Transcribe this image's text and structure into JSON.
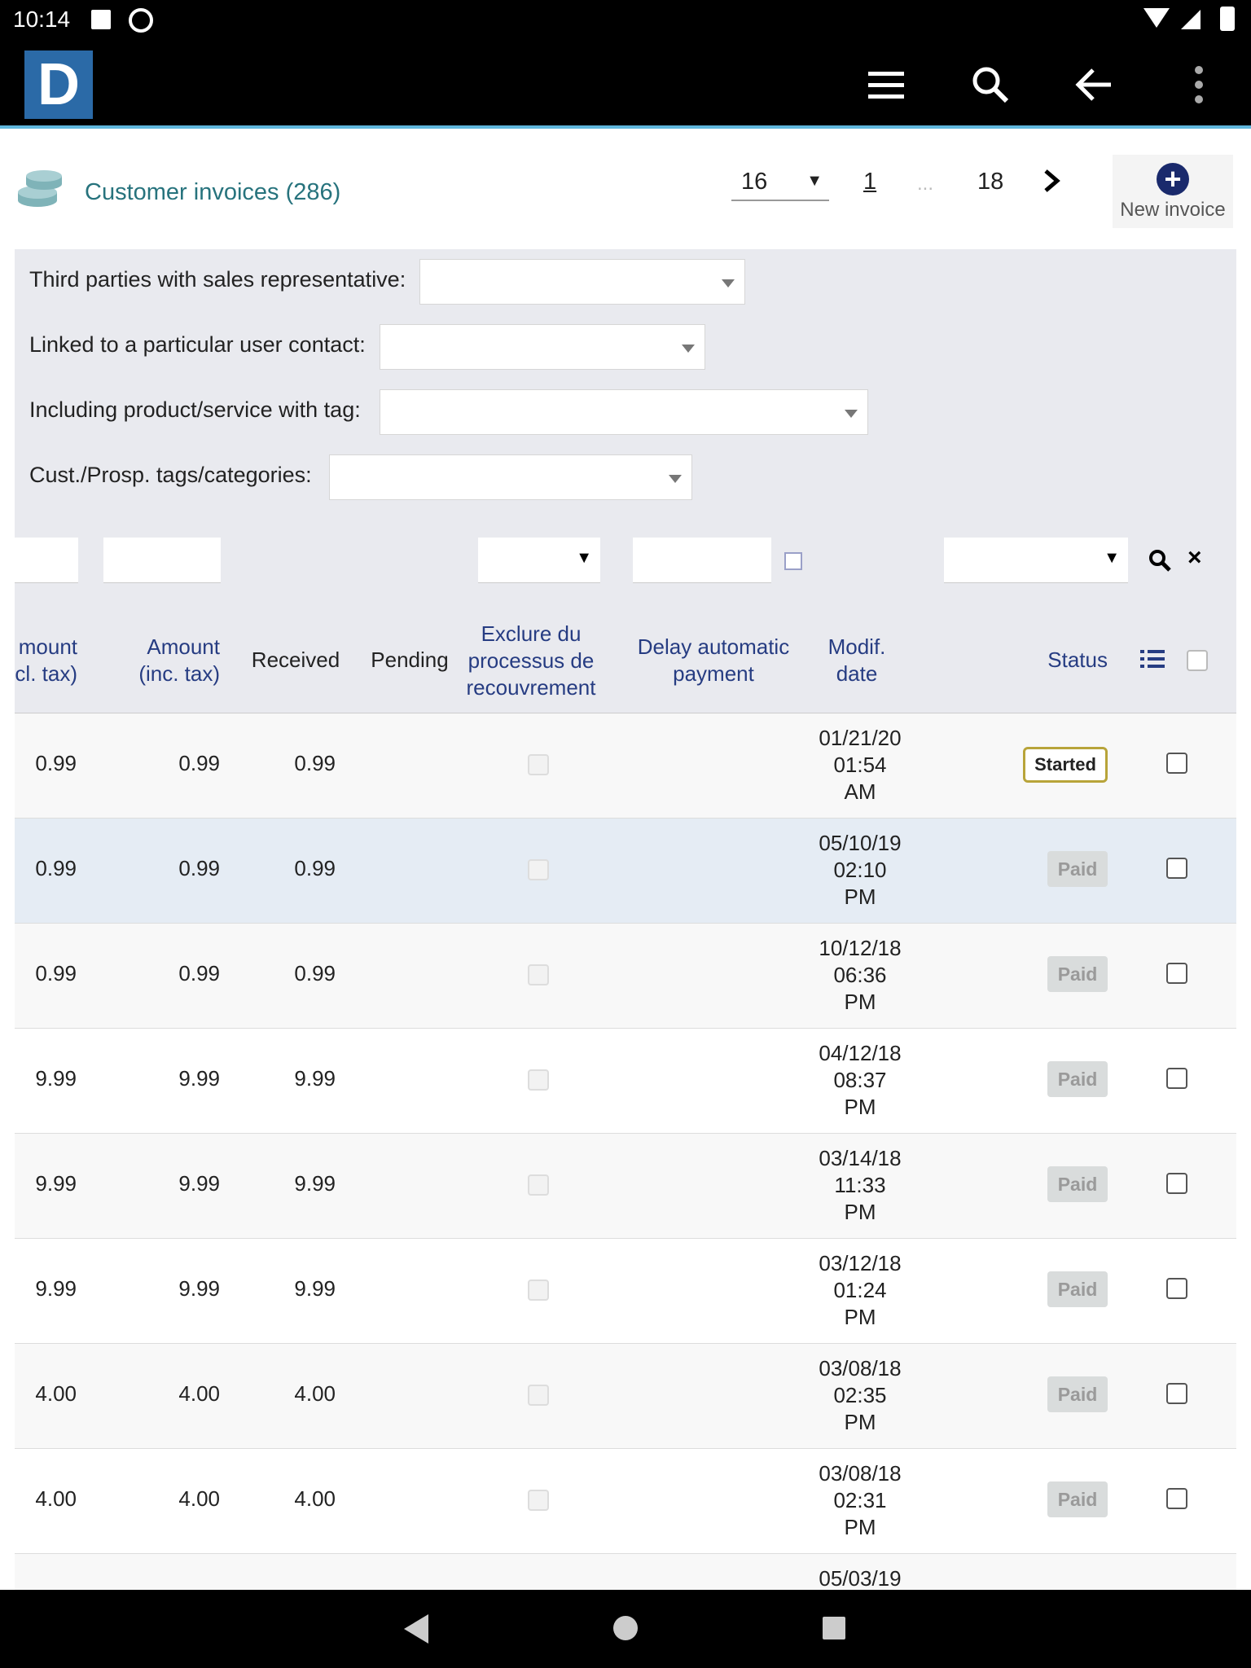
{
  "statusbar": {
    "time": "10:14"
  },
  "header": {
    "logo_letter": "D"
  },
  "list": {
    "title": "Customer invoices (286)",
    "page_size": "16",
    "current_page": "1",
    "dots": "...",
    "last_page": "18",
    "new_invoice_label": "New invoice"
  },
  "filters": {
    "sales_rep_label": "Third parties with sales representative:",
    "user_contact_label": "Linked to a particular user contact:",
    "product_tag_label": "Including product/service with tag:",
    "cust_tags_label": "Cust./Prosp. tags/categories:"
  },
  "columns": {
    "amount_excl_1": "mount",
    "amount_excl_2": "cl. tax)",
    "amount_inc_1": "Amount",
    "amount_inc_2": "(inc. tax)",
    "received": "Received",
    "pending": "Pending",
    "exclude_1": "Exclure du",
    "exclude_2": "processus de",
    "exclude_3": "recouvrement",
    "delay_1": "Delay automatic",
    "delay_2": "payment",
    "modif_1": "Modif.",
    "modif_2": "date",
    "status": "Status"
  },
  "rows": [
    {
      "excl": "0.99",
      "inc": "0.99",
      "received": "0.99",
      "d1": "01/21/20",
      "d2": "01:54",
      "d3": "AM",
      "status": "Started"
    },
    {
      "excl": "0.99",
      "inc": "0.99",
      "received": "0.99",
      "d1": "05/10/19",
      "d2": "02:10",
      "d3": "PM",
      "status": "Paid"
    },
    {
      "excl": "0.99",
      "inc": "0.99",
      "received": "0.99",
      "d1": "10/12/18",
      "d2": "06:36",
      "d3": "PM",
      "status": "Paid"
    },
    {
      "excl": "9.99",
      "inc": "9.99",
      "received": "9.99",
      "d1": "04/12/18",
      "d2": "08:37",
      "d3": "PM",
      "status": "Paid"
    },
    {
      "excl": "9.99",
      "inc": "9.99",
      "received": "9.99",
      "d1": "03/14/18",
      "d2": "11:33",
      "d3": "PM",
      "status": "Paid"
    },
    {
      "excl": "9.99",
      "inc": "9.99",
      "received": "9.99",
      "d1": "03/12/18",
      "d2": "01:24",
      "d3": "PM",
      "status": "Paid"
    },
    {
      "excl": "4.00",
      "inc": "4.00",
      "received": "4.00",
      "d1": "03/08/18",
      "d2": "02:35",
      "d3": "PM",
      "status": "Paid"
    },
    {
      "excl": "4.00",
      "inc": "4.00",
      "received": "4.00",
      "d1": "03/08/18",
      "d2": "02:31",
      "d3": "PM",
      "status": "Paid"
    }
  ],
  "partial_row": {
    "d1": "05/03/19"
  },
  "colors": {
    "accent": "#27737d",
    "header_text": "#263c82",
    "started_border": "#b8a43a",
    "topbar_line": "#5fb6dc"
  }
}
